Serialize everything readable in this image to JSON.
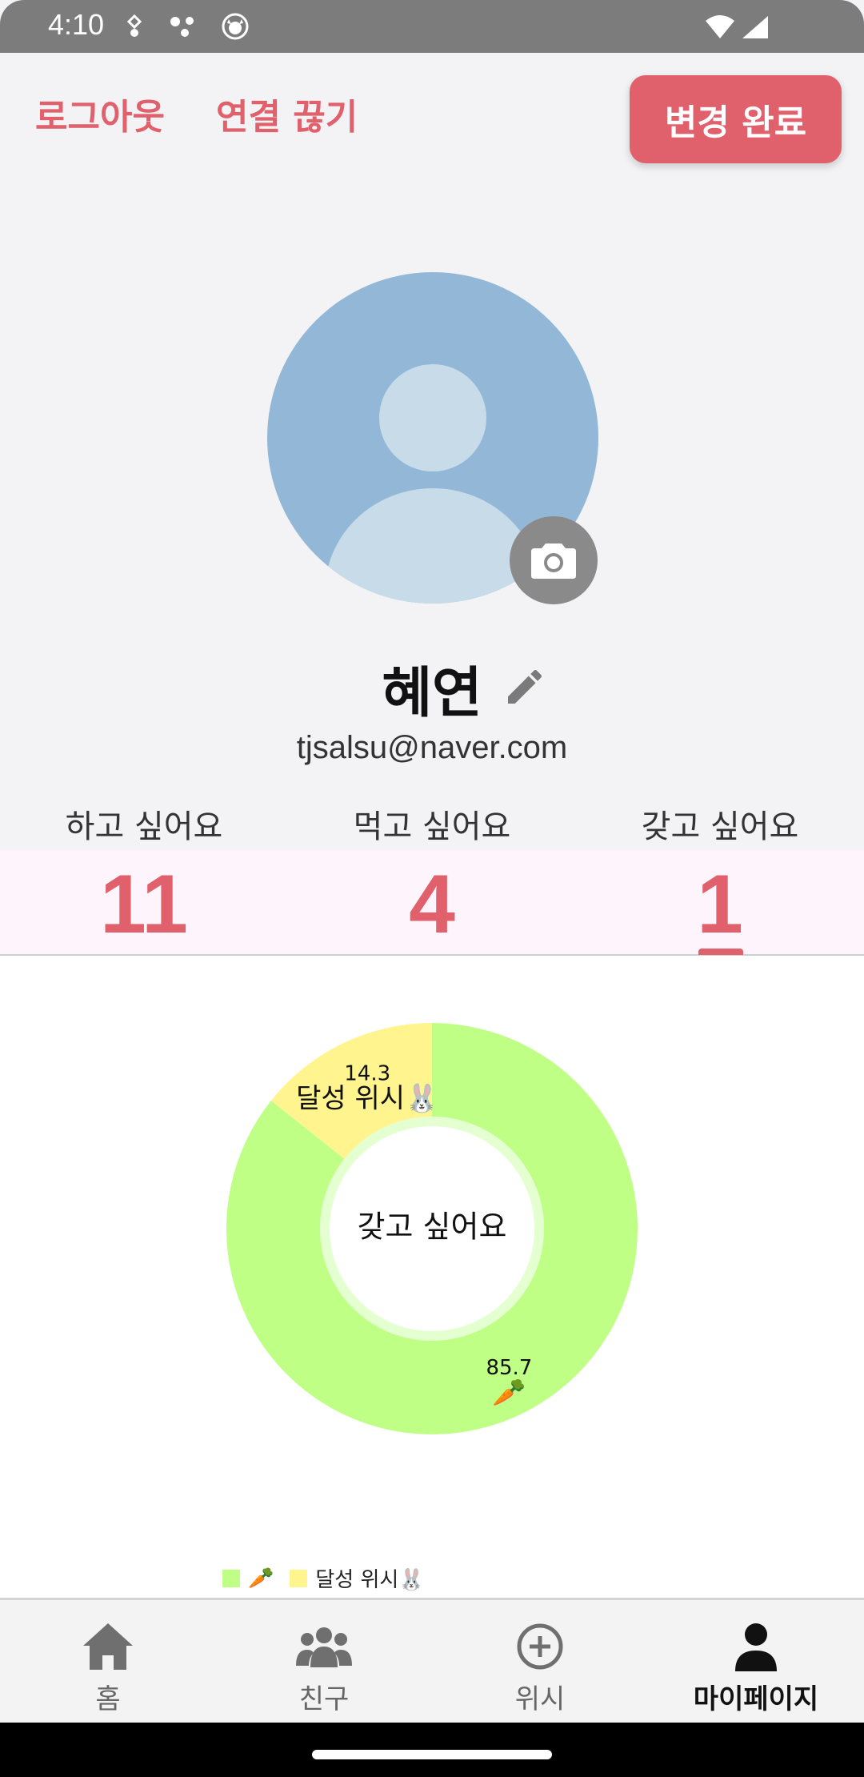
{
  "status_bar": {
    "time": "4:10",
    "left_icons": [
      "notification-dot-icon",
      "network-dots-icon",
      "cat-face-icon"
    ],
    "right_icons": [
      "wifi-icon",
      "cellular-signal-icon"
    ]
  },
  "header": {
    "logout_label": "로그아웃",
    "disconnect_label": "연결 끊기",
    "done_label": "변경 완료"
  },
  "profile": {
    "name": "혜연",
    "email": "tjsalsu@naver.com",
    "avatar_icon": "default-avatar",
    "camera_icon": "camera-icon",
    "edit_icon": "pencil-icon"
  },
  "stats": [
    {
      "label": "하고 싶어요",
      "value": "11"
    },
    {
      "label": "먹고 싶어요",
      "value": "4"
    },
    {
      "label": "갖고 싶어요",
      "value": "1"
    }
  ],
  "selected_stat": 2,
  "chart_data": {
    "type": "pie",
    "subtype": "donut",
    "center_label": "갖고 싶어요",
    "slices": [
      {
        "label": "🥕",
        "value": 85.7,
        "color": "#bfff86"
      },
      {
        "label": "달성 위시🐰",
        "value": 14.3,
        "color": "#fff48e"
      }
    ],
    "legend": [
      {
        "label": "🥕",
        "color": "#bfff86"
      },
      {
        "label": "달성 위시🐰",
        "color": "#fff48e"
      }
    ],
    "legend_position": "bottom"
  },
  "bottom_nav": [
    {
      "label": "홈",
      "icon": "home-icon",
      "active": false
    },
    {
      "label": "친구",
      "icon": "friends-icon",
      "active": false
    },
    {
      "label": "위시",
      "icon": "add-circle-icon",
      "active": false
    },
    {
      "label": "마이페이지",
      "icon": "person-icon",
      "active": true
    }
  ],
  "colors": {
    "accent": "#e0606b",
    "avatar_bg": "#93b8d7",
    "count_band": "#fdf5fb"
  }
}
